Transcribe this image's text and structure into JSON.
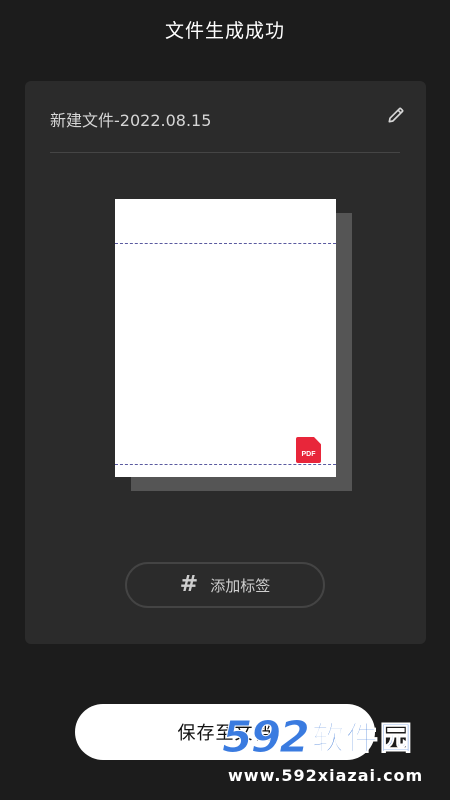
{
  "header": {
    "title": "文件生成成功"
  },
  "card": {
    "file_name": "新建文件-2022.08.15",
    "edit_icon": "pencil-icon",
    "preview": {
      "badge_label": "PDF",
      "badge_color": "#e8263a"
    },
    "tag_button": {
      "icon": "hash-icon",
      "icon_glyph": "#",
      "label": "添加标签"
    }
  },
  "footer": {
    "save_label": "保存至文档"
  },
  "watermark": {
    "number": "592",
    "name": "软件园",
    "url": "www.592xiazai.com"
  },
  "colors": {
    "background": "#1c1c1c",
    "card": "#2b2b2b",
    "save_button": "#ffffff"
  }
}
